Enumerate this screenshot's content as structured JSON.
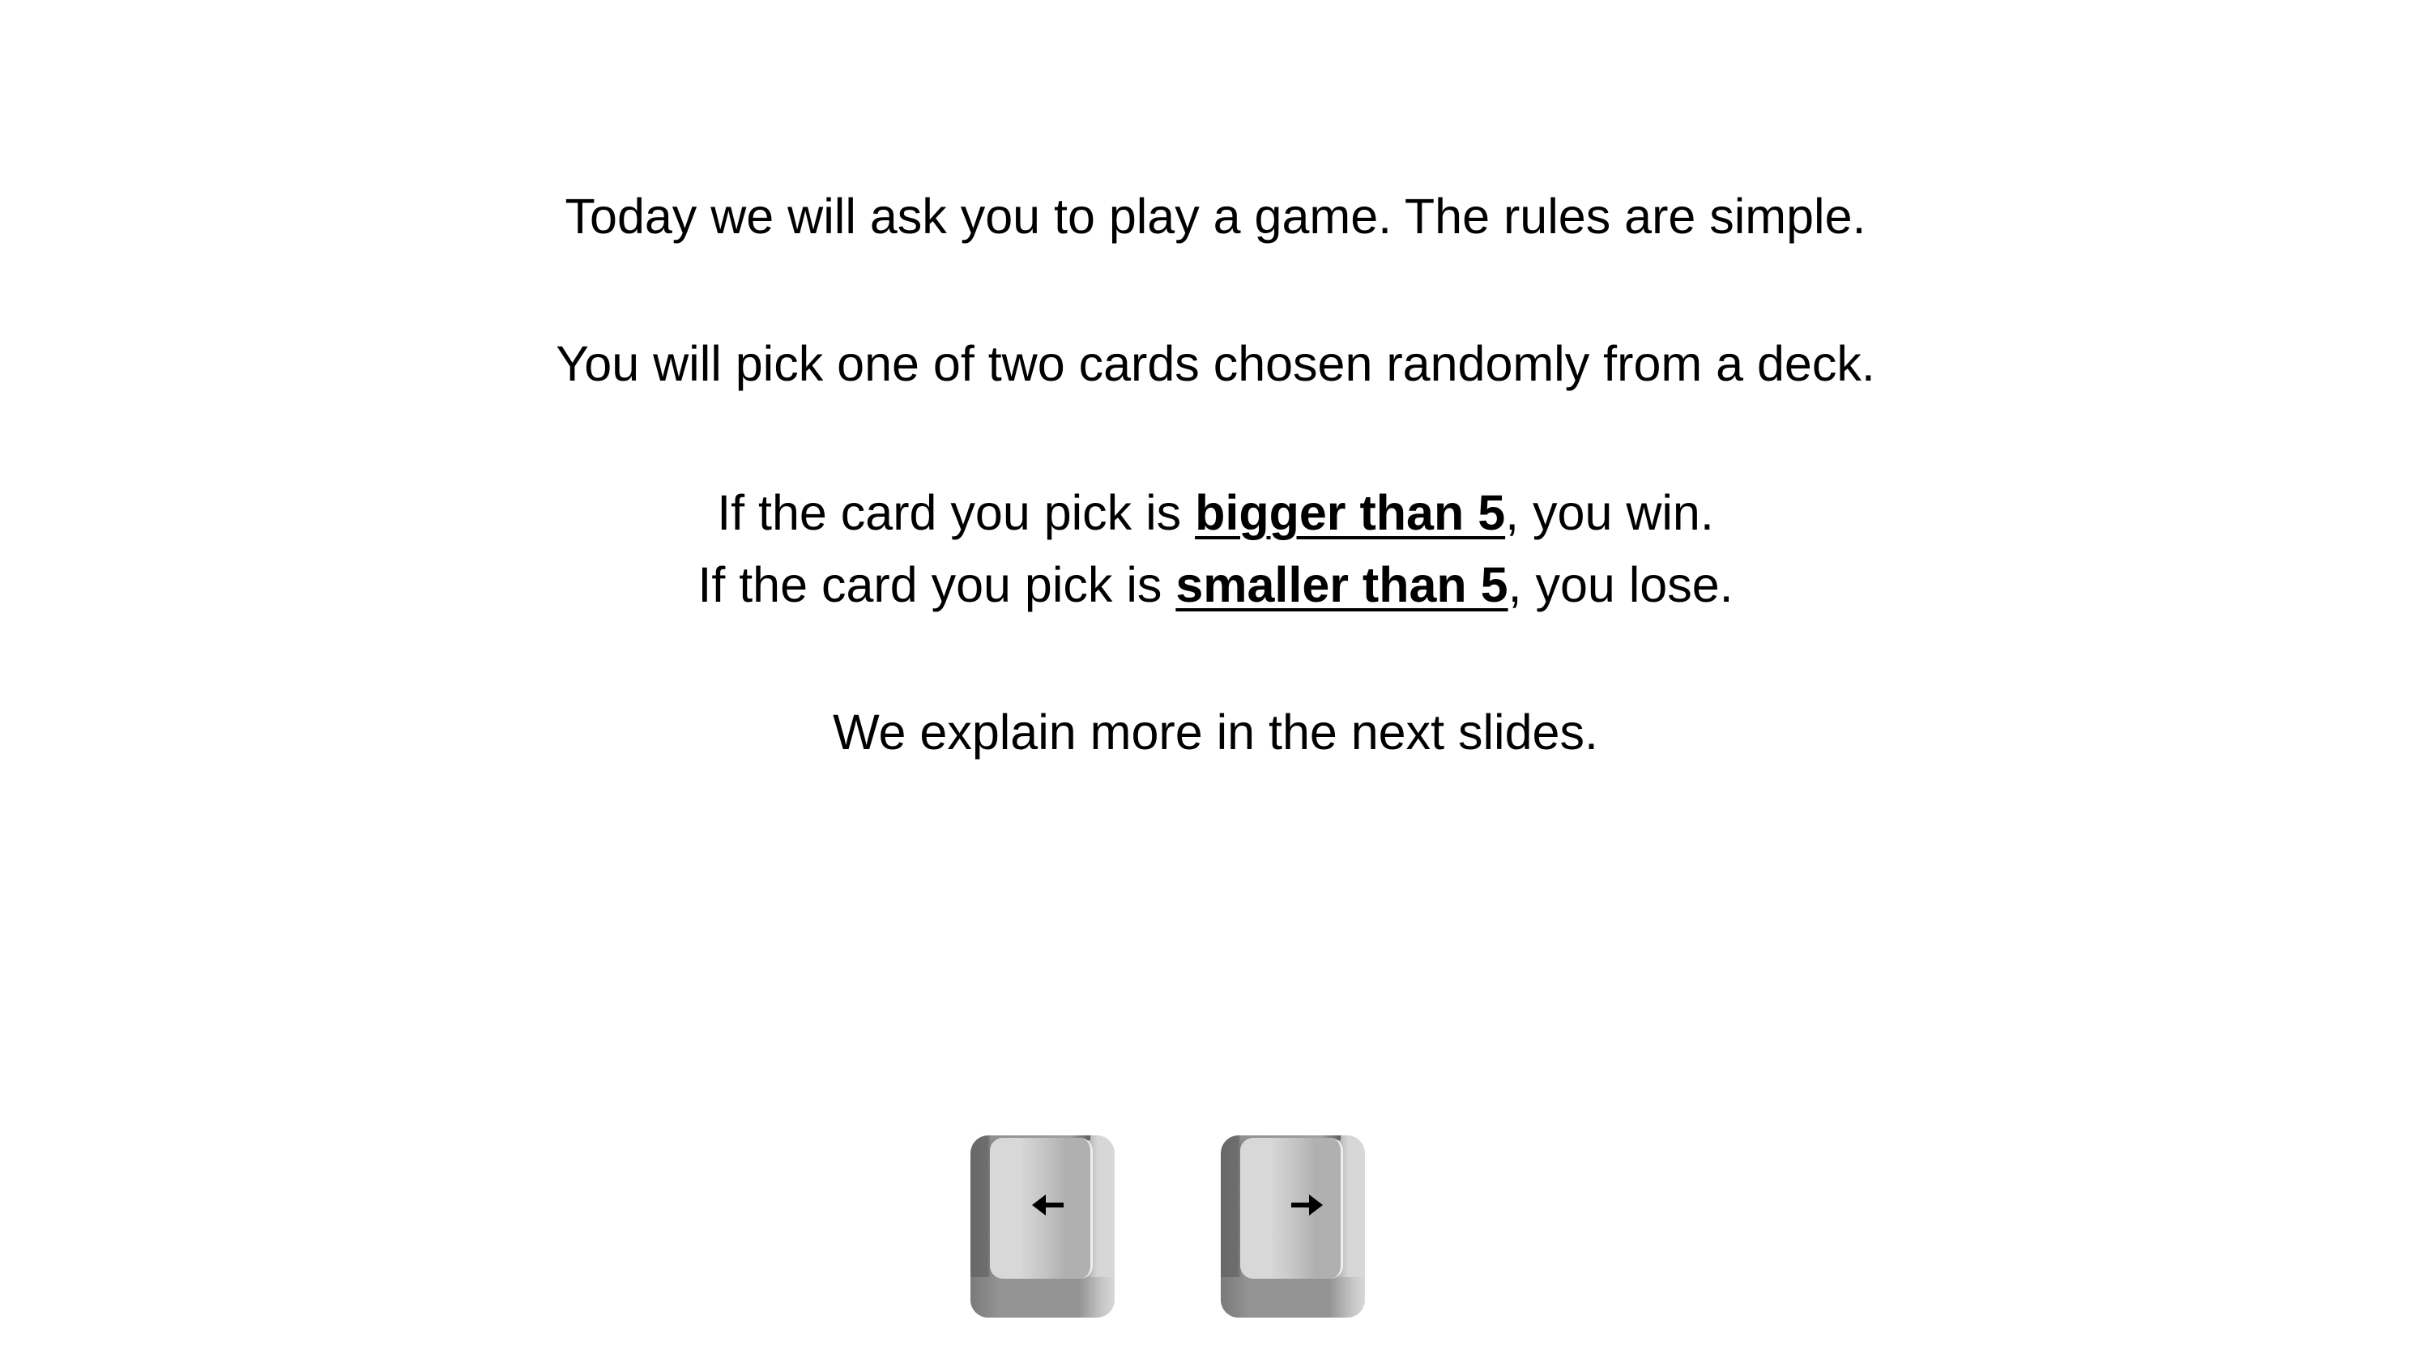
{
  "slide": {
    "line1": "Today we will ask you to play a game. The rules are simple.",
    "line2": "You will pick one of two cards chosen randomly from a deck.",
    "line3": {
      "pre": "If the card you pick is ",
      "emph": "bigger than 5",
      "post": ", you win."
    },
    "line4": {
      "pre": "If the card you pick is ",
      "emph": "smaller than 5",
      "post": ", you lose."
    },
    "line5": "We explain more in the next slides."
  },
  "keys": [
    {
      "name": "left-arrow-key",
      "icon": "arrow-left-icon"
    },
    {
      "name": "right-arrow-key",
      "icon": "arrow-right-icon"
    }
  ]
}
